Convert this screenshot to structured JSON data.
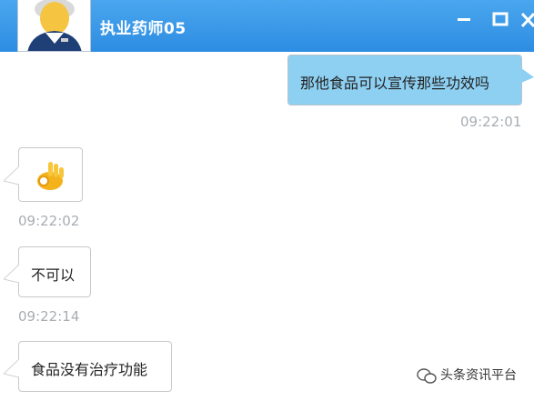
{
  "window": {
    "title": "执业药师05",
    "controls": {
      "minimize": "minimize-icon",
      "maximize": "maximize-icon",
      "close": "close-icon"
    }
  },
  "contact": {
    "avatar_icon": "pharmacist-avatar"
  },
  "messages": [
    {
      "side": "right",
      "text": "那他食品可以宣传那些功效吗",
      "time": "09:22:01"
    },
    {
      "side": "left",
      "type": "emoji",
      "emoji": "ok-hand-emoji",
      "time": "09:22:02"
    },
    {
      "side": "left",
      "text": "不可以",
      "time": "09:22:14"
    },
    {
      "side": "left",
      "text": "食品没有治疗功能"
    }
  ],
  "watermark": {
    "text": "头条资讯平台",
    "icon": "wechat-logo"
  },
  "colors": {
    "titlebar": "#3a98e8",
    "right_bubble": "#8ed0f2",
    "timestamp": "#a8adb3"
  }
}
